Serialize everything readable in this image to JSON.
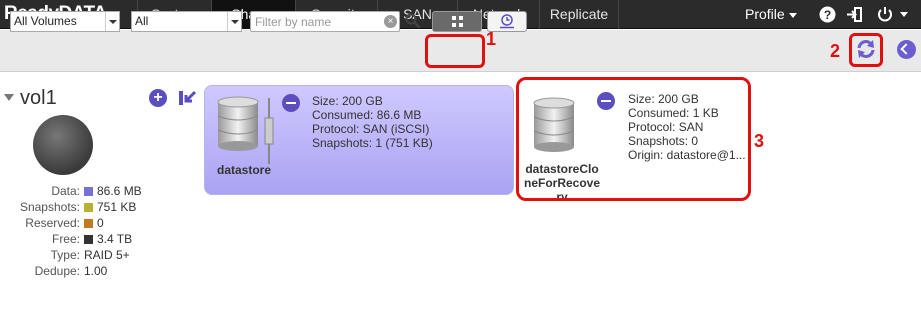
{
  "app": {
    "logo": "ReadyDATA"
  },
  "nav": {
    "tabs": [
      {
        "label": "System"
      },
      {
        "label": "Shares"
      },
      {
        "label": "Security"
      },
      {
        "label": "SAN"
      },
      {
        "label": "Network"
      },
      {
        "label": "Replicate"
      }
    ],
    "active_tab": "Shares",
    "profile_label": "Profile",
    "icons": [
      "help-icon",
      "logout-icon",
      "power-icon"
    ]
  },
  "toolbar": {
    "volume_select": "All Volumes",
    "type_select": "All",
    "filter_placeholder": "Filter by name",
    "filter_value": "",
    "view_modes": [
      "grid-view-icon",
      "timeline-view-icon"
    ]
  },
  "annotations": {
    "label1": "1",
    "label2": "2",
    "label3": "3",
    "color": "#e01010"
  },
  "volume": {
    "name": "vol1",
    "stats": [
      {
        "label": "Data:",
        "value": "86.6 MB",
        "color": "#7a6fd6"
      },
      {
        "label": "Snapshots:",
        "value": "751 KB",
        "color": "#b8b030"
      },
      {
        "label": "Reserved:",
        "value": "0",
        "color": "#c07a20"
      },
      {
        "label": "Free:",
        "value": "3.4 TB",
        "color": "#333333"
      },
      {
        "label": "Type:",
        "value": "RAID 5+"
      },
      {
        "label": "Dedupe:",
        "value": "1.00"
      }
    ]
  },
  "shares": [
    {
      "name": "datastore",
      "size": "Size: 200 GB",
      "consumed": "Consumed: 86.6 MB",
      "protocol": "Protocol: SAN (iSCSI)",
      "snapshots": "Snapshots: 1 (751 KB)"
    },
    {
      "name_line1": "datastoreClo",
      "name_line2": "neForRecove",
      "name_line3": "ry",
      "size": "Size: 200 GB",
      "consumed": "Consumed: 1 KB",
      "protocol": "Protocol: SAN",
      "snapshots": "Snapshots: 0",
      "origin": "Origin: datastore@1..."
    }
  ]
}
